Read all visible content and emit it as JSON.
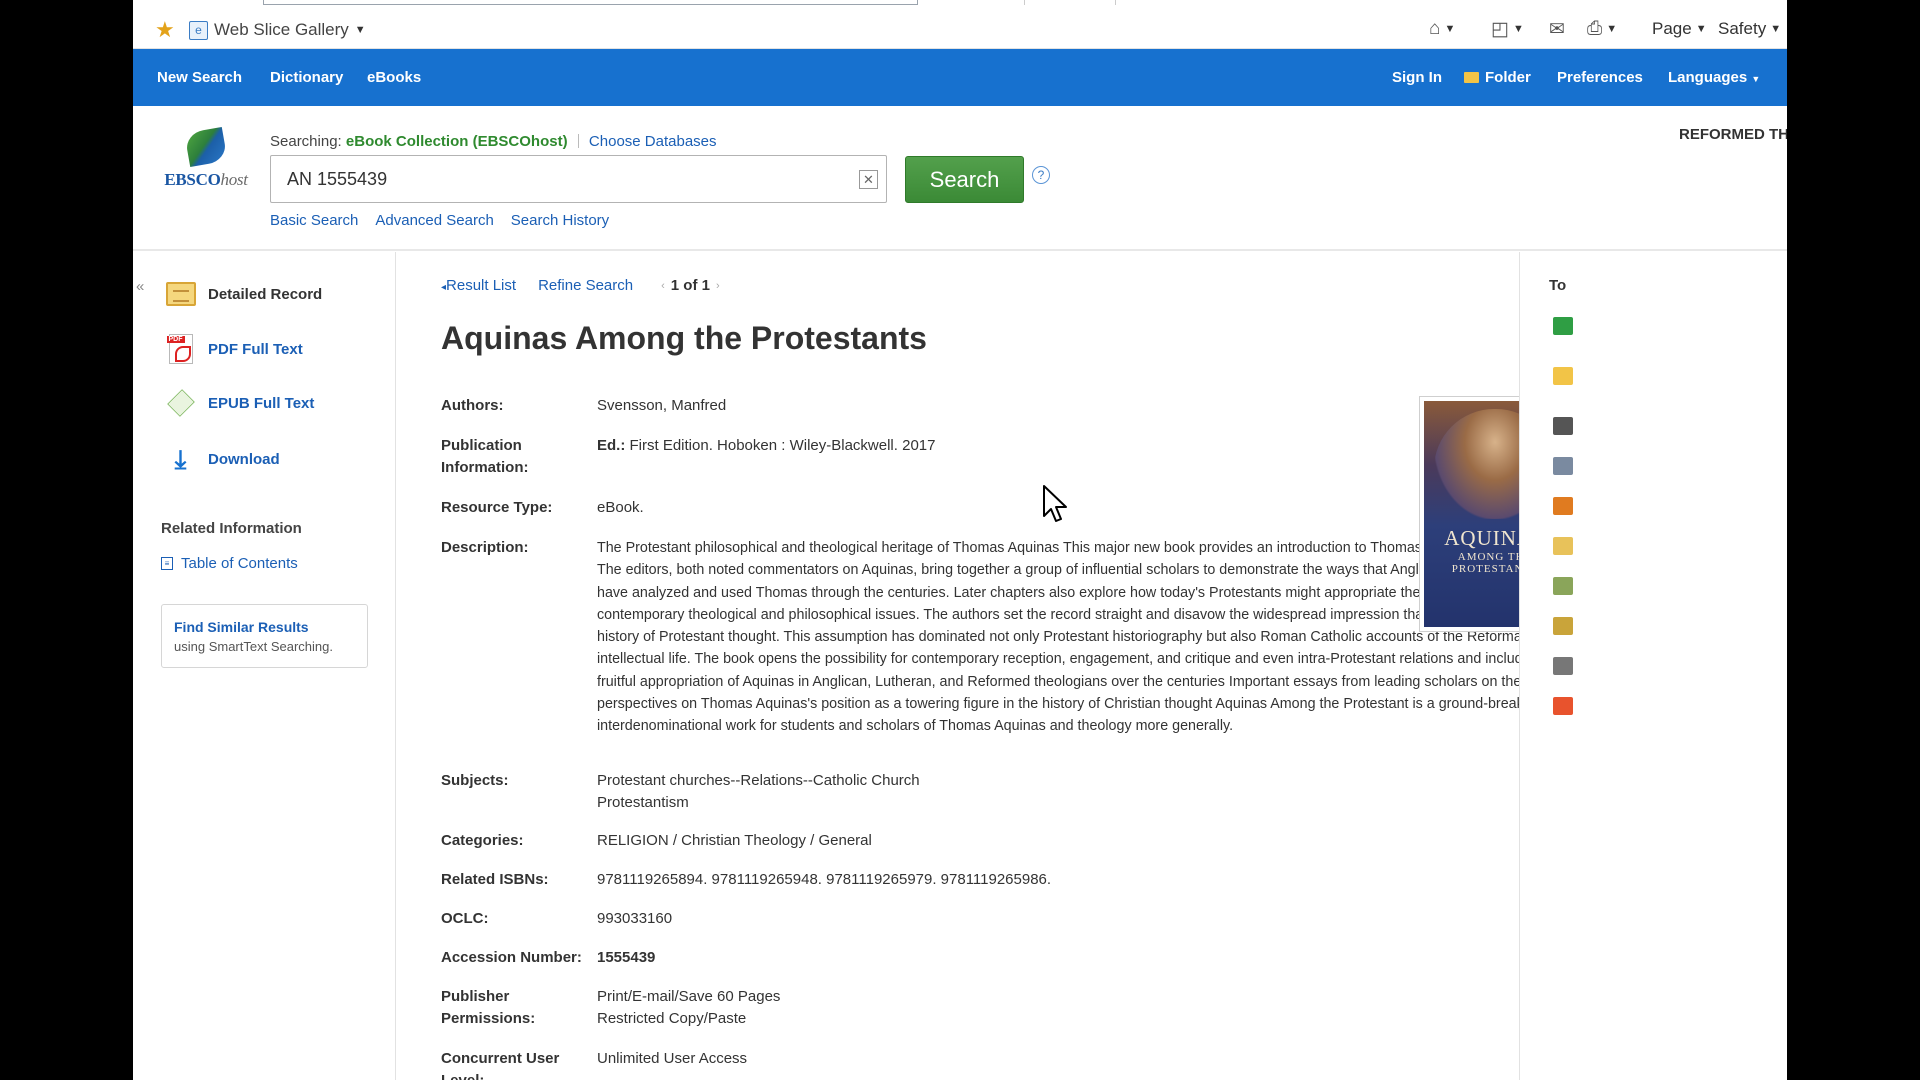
{
  "browser": {
    "web_slice_label": "Web Slice Gallery",
    "page_label": "Page",
    "safety_label": "Safety",
    "icons": [
      "favorites-star-icon",
      "home-icon",
      "feeds-icon",
      "mail-icon",
      "print-icon"
    ]
  },
  "nav": {
    "new_search": "New Search",
    "dictionary": "Dictionary",
    "ebooks": "eBooks",
    "sign_in": "Sign In",
    "folder": "Folder",
    "preferences": "Preferences",
    "languages": "Languages"
  },
  "header": {
    "logo_ebsco": "EBSCO",
    "logo_host": "host",
    "searching_label": "Searching:",
    "database": "eBook Collection (EBSCOhost)",
    "choose_databases": "Choose Databases",
    "search_value": "AN 1555439",
    "search_button": "Search",
    "help": "?",
    "basic_search": "Basic Search",
    "advanced_search": "Advanced Search",
    "search_history": "Search History",
    "brand_text": "REFORMED TH"
  },
  "sidebar": {
    "items": [
      {
        "label": "Detailed Record",
        "icon": "detailed-record-icon"
      },
      {
        "label": "PDF Full Text",
        "icon": "pdf-icon"
      },
      {
        "label": "EPUB Full Text",
        "icon": "epub-icon"
      },
      {
        "label": "Download",
        "icon": "download-icon"
      }
    ],
    "related_title": "Related Information",
    "table_of_contents": "Table of Contents",
    "find_similar": "Find Similar Results",
    "find_similar_sub": "using SmartText Searching."
  },
  "record_nav": {
    "result_list": "Result List",
    "refine_search": "Refine Search",
    "pager": "1 of 1"
  },
  "record": {
    "title": "Aquinas Among the Protestants",
    "authors_label": "Authors:",
    "authors": "Svensson, Manfred",
    "pubinfo_label_1": "Publication",
    "pubinfo_label_2": "Information:",
    "pubinfo_ed": "Ed.:",
    "pubinfo": " First Edition. Hoboken : Wiley-Blackwell. 2017",
    "resource_type_label": "Resource Type:",
    "resource_type": "eBook.",
    "description_label": "Description:",
    "description": "The Protestant philosophical and theological heritage of Thomas Aquinas This major new book provides an introduction to Thomas Aquinas's influence on Protestantism. The editors, both noted commentators on Aquinas, bring together a group of influential scholars to demonstrate the ways that Anglican, Lutheran, and Reformed thinkers have analyzed and used Thomas through the centuries. Later chapters also explore how today's Protestants might appropriate the work of Aquinas to address a number of contemporary theological and philosophical issues. The authors set the record straight and disavow the widespread impression that Aquinas is an irrelevant figure for the history of Protestant thought. This assumption has dominated not only Protestant historiography but also Roman Catholic accounts of the Reformation and Protestant intellectual life. The book opens the possibility for contemporary reception, engagement, and critique and even intra-Protestant relations and includes: Information on the fruitful appropriation of Aquinas in Anglican, Lutheran, and Reformed theologians over the centuries Important essays from leading scholars on the teachings of Aquinas New perspectives on Thomas Aquinas's position as a towering figure in the history of Christian thought Aquinas Among the Protestant is a ground-breaking and interdenominational work for students and scholars of Thomas Aquinas and theology more generally.",
    "subjects_label": "Subjects:",
    "subjects": [
      "Protestant churches--Relations--Catholic Church",
      "Protestantism"
    ],
    "categories_label": "Categories:",
    "categories": "RELIGION / Christian Theology / General",
    "isbns_label": "Related ISBNs:",
    "isbns": "9781119265894. 9781119265948. 9781119265979. 9781119265986.",
    "oclc_label": "OCLC:",
    "oclc": "993033160",
    "accession_label": "Accession Number:",
    "accession": "1555439",
    "permissions_label_1": "Publisher",
    "permissions_label_2": "Permissions:",
    "permissions_1": "Print/E-mail/Save 60 Pages",
    "permissions_2": "Restricted Copy/Paste",
    "concurrent_label_1": "Concurrent User",
    "concurrent_label_2": "Level:",
    "concurrent": "Unlimited User Access"
  },
  "cover": {
    "title": "AQUINAS",
    "subtitle": "AMONG THE PROTESTANTS"
  },
  "tools": {
    "label": "To",
    "icons": [
      "google-drive-icon",
      "add-to-folder-icon",
      "print-icon",
      "email-icon",
      "save-icon",
      "cite-icon",
      "export-icon",
      "create-note-icon",
      "permalink-icon",
      "share-icon"
    ],
    "colors": [
      "#2f9e44",
      "#f2c447",
      "#555555",
      "#7a8aa0",
      "#e07b20",
      "#e8c25a",
      "#8aa55a",
      "#c9a43a",
      "#777777",
      "#e8532d"
    ]
  }
}
